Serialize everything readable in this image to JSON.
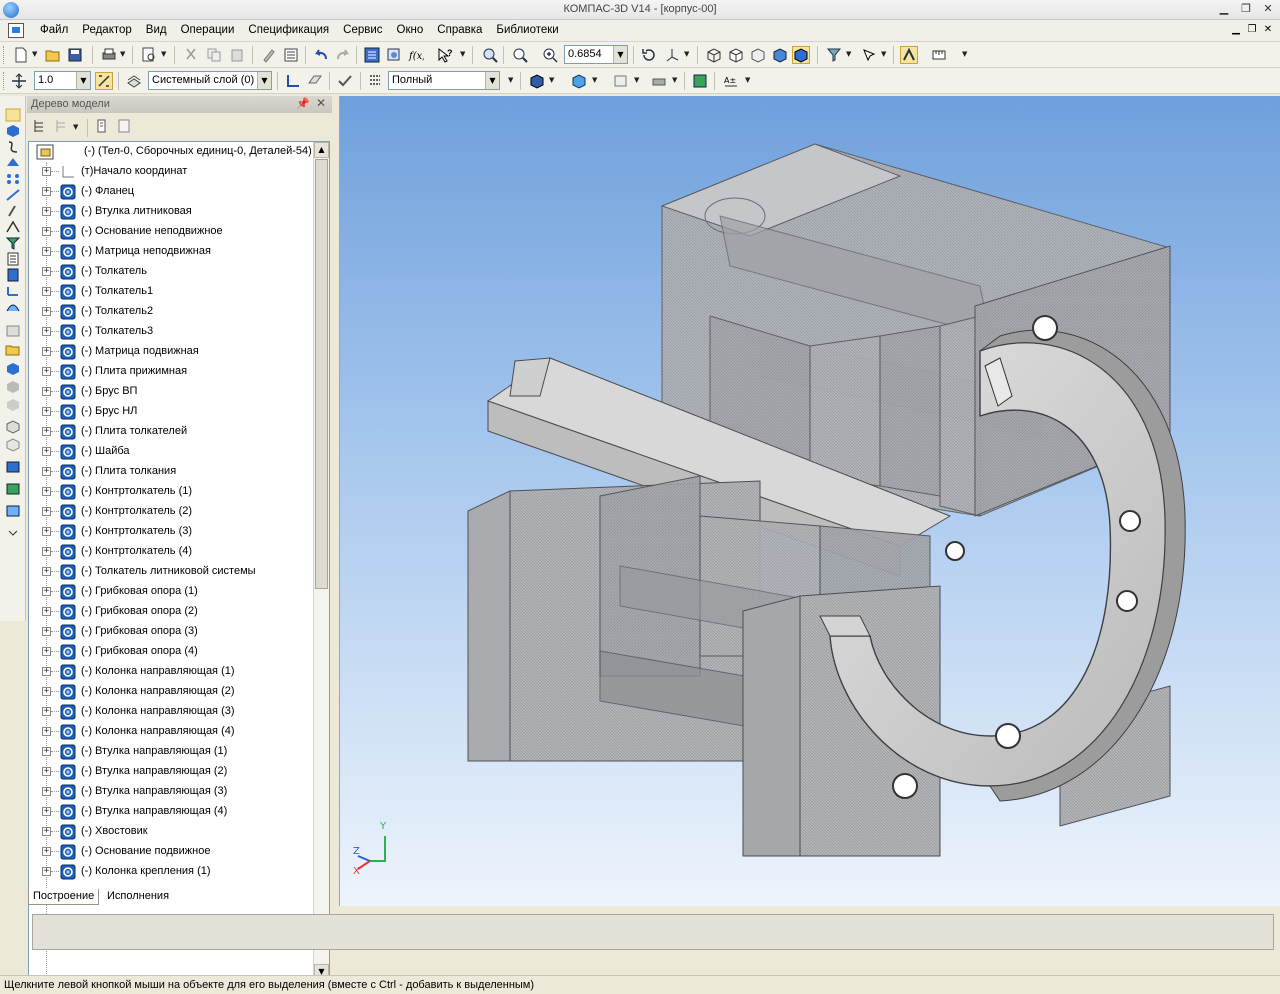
{
  "window": {
    "title": "КОМПАС-3D V14 - [корпус-00]"
  },
  "menu": [
    "Файл",
    "Редактор",
    "Вид",
    "Операции",
    "Спецификация",
    "Сервис",
    "Окно",
    "Справка",
    "Библиотеки"
  ],
  "toolbar_top": {
    "zoom_value": "0.6854"
  },
  "toolbar_second": {
    "step_value": "1.0",
    "layer_value": "Системный слой (0)",
    "style_value": "Полный"
  },
  "tree_panel": {
    "title": "Дерево модели",
    "root": "(-)  (Тел-0, Сборочных единиц-0, Деталей-54)",
    "items": [
      "(т)Начало координат",
      "(-) Фланец",
      "(-) Втулка литниковая",
      "(-) Основание неподвижное",
      "(-) Матрица неподвижная",
      "(-) Толкатель",
      "(-) Толкатель1",
      "(-) Толкатель2",
      "(-) Толкатель3",
      "(-) Матрица подвижная",
      "(-) Плита прижимная",
      "(-) Брус ВП",
      "(-) Брус НЛ",
      "(-) Плита толкателей",
      "(-) Шайба",
      "(-) Плита толкания",
      "(-) Контртолкатель (1)",
      "(-) Контртолкатель (2)",
      "(-) Контртолкатель (3)",
      "(-) Контртолкатель (4)",
      "(-) Толкатель литниковой системы",
      "(-) Грибковая опора (1)",
      "(-) Грибковая опора (2)",
      "(-) Грибковая опора (3)",
      "(-) Грибковая опора (4)",
      "(-) Колонка направляющая (1)",
      "(-) Колонка направляющая (2)",
      "(-) Колонка направляющая (3)",
      "(-) Колонка направляющая (4)",
      "(-) Втулка направляющая (1)",
      "(-) Втулка направляющая (2)",
      "(-) Втулка направляющая (3)",
      "(-) Втулка направляющая (4)",
      "(-) Хвостовик",
      "(-) Основание подвижное",
      "(-) Колонка крепления (1)"
    ],
    "tabs": [
      "Построение",
      "Исполнения"
    ]
  },
  "axes": {
    "x": "X",
    "y": "Y",
    "z": "Z"
  },
  "status_text": "Щелкните левой кнопкой мыши на объекте для его выделения (вместе с Ctrl - добавить к выделенным)",
  "colors": {
    "accent": "#1f6fc9",
    "part_icon": "#1e5fb8",
    "viewport_top": "#6fa0dc",
    "viewport_bottom": "#eef4fc"
  }
}
